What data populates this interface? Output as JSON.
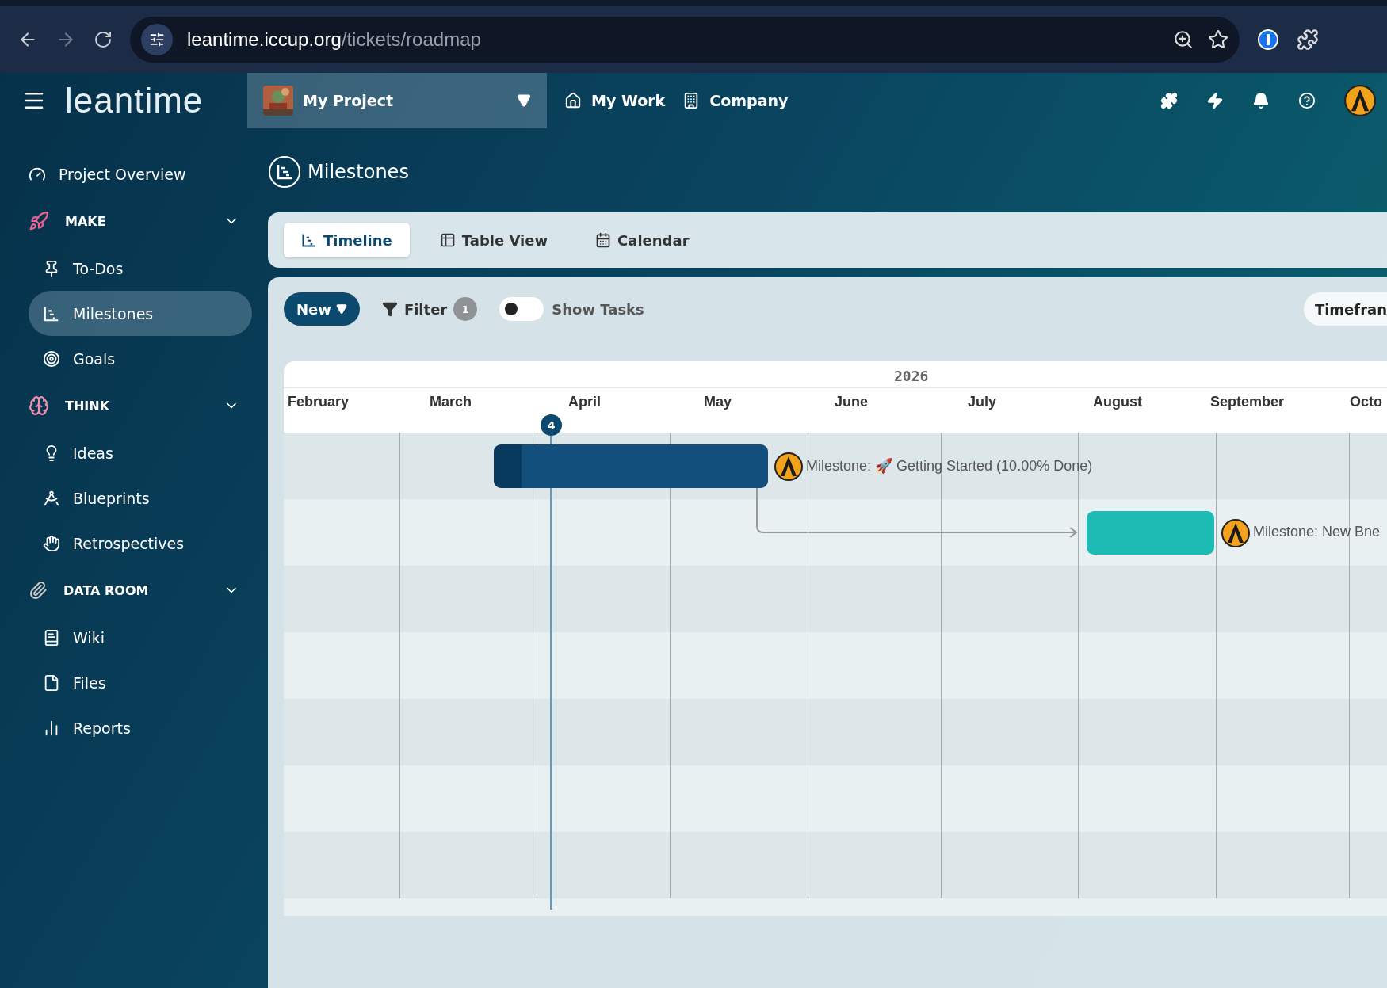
{
  "browser": {
    "url_host": "leantime.iccup.org",
    "url_path": "/tickets/roadmap"
  },
  "header": {
    "logo": "leantime",
    "project": "My Project",
    "nav": [
      "My Work",
      "Company"
    ]
  },
  "sidebar": {
    "overview": "Project Overview",
    "sections": [
      {
        "title": "MAKE",
        "expanded": true,
        "items": [
          {
            "label": "To-Dos",
            "selected": false
          },
          {
            "label": "Milestones",
            "selected": true
          },
          {
            "label": "Goals",
            "selected": false
          }
        ]
      },
      {
        "title": "THINK",
        "expanded": true,
        "items": [
          {
            "label": "Ideas",
            "selected": false
          },
          {
            "label": "Blueprints",
            "selected": false
          },
          {
            "label": "Retrospectives",
            "selected": false
          }
        ]
      },
      {
        "title": "DATA ROOM",
        "expanded": true,
        "items": [
          {
            "label": "Wiki",
            "selected": false
          },
          {
            "label": "Files",
            "selected": false
          },
          {
            "label": "Reports",
            "selected": false
          }
        ]
      }
    ]
  },
  "page_title": "Milestones",
  "tabs": [
    {
      "label": "Timeline",
      "selected": true
    },
    {
      "label": "Table View",
      "selected": false
    },
    {
      "label": "Calendar",
      "selected": false
    }
  ],
  "toolbar": {
    "new_button": "New",
    "filter": "Filter",
    "filter_count": "1",
    "show_tasks": {
      "label": "Show Tasks",
      "on": false
    },
    "timeframe": "Timefran"
  },
  "timeline": {
    "year": "2026",
    "months": [
      "February",
      "March",
      "April",
      "May",
      "June",
      "July",
      "August",
      "September",
      "Octo"
    ],
    "today_marker": "4",
    "milestones": [
      {
        "label": "Milestone: 🚀 Getting Started (10.00% Done)",
        "color": "#134f7c",
        "level": 0.1
      },
      {
        "label": "Milestone: New Bne",
        "color": "#1dbbb4",
        "level": 0
      }
    ]
  }
}
